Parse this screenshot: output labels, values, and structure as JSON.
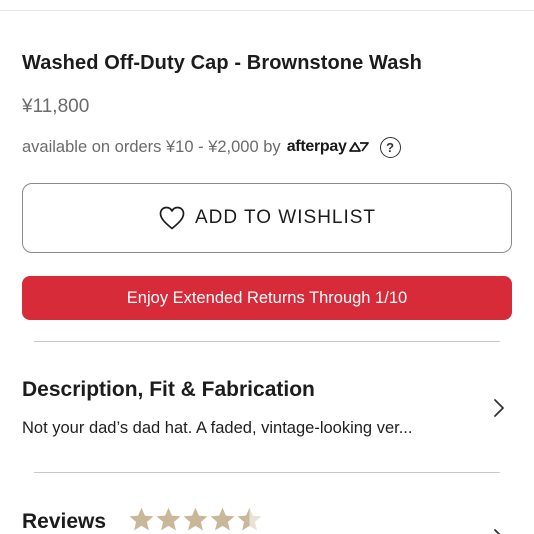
{
  "product": {
    "title": "Washed Off-Duty Cap - Brownstone Wash",
    "price": "¥11,800"
  },
  "afterpay": {
    "text": "available on orders ¥10 - ¥2,000 by",
    "brand": "afterpay",
    "help_icon": "?"
  },
  "wishlist": {
    "label": "ADD TO WISHLIST",
    "icon": "heart-outline-icon"
  },
  "promo": {
    "label": "Enjoy Extended Returns Through 1/10",
    "color": "#d72b3a"
  },
  "description": {
    "title": "Description, Fit & Fabrication",
    "preview": "Not your dad’s dad hat. A faded, vintage-looking ver...",
    "icon": "chevron-right-icon"
  },
  "reviews": {
    "title": "Reviews",
    "rating": 4.5,
    "max_rating": 5,
    "star_color": "#c9b79a"
  }
}
